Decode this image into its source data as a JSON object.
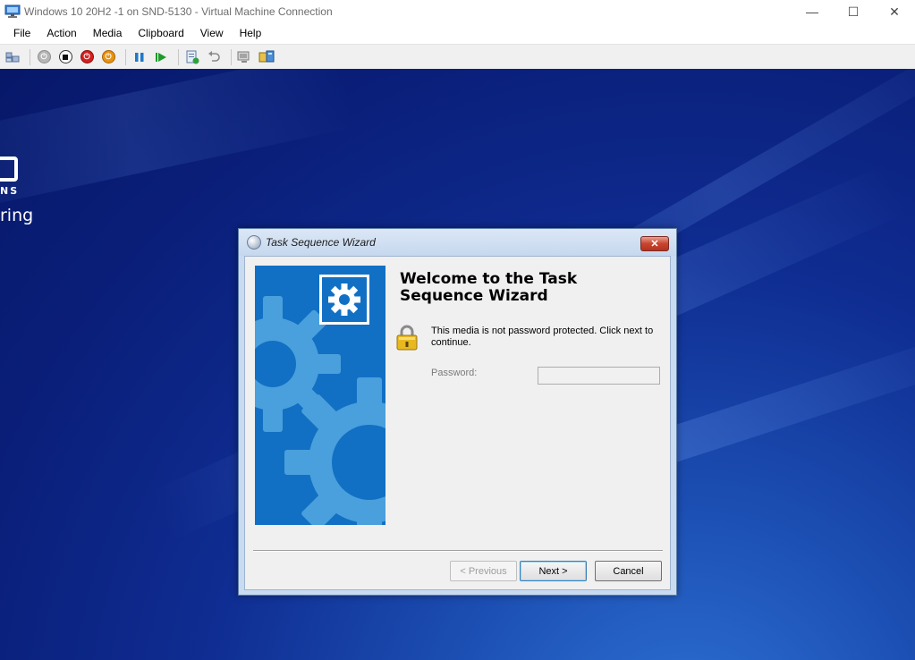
{
  "window": {
    "title": "Windows 10 20H2 -1 on SND-5130 - Virtual Machine Connection",
    "minimize": "—",
    "maximize": "☐",
    "close": "✕"
  },
  "menu": {
    "items": [
      "File",
      "Action",
      "Media",
      "Clipboard",
      "View",
      "Help"
    ]
  },
  "toolbar": {
    "icons": [
      "ctrl-alt-del-icon",
      "start-icon",
      "turn-off-icon",
      "shutdown-icon",
      "save-icon",
      "pause-icon",
      "reset-icon",
      "checkpoint-icon",
      "revert-icon",
      "enhanced-session-icon",
      "share-icon"
    ]
  },
  "desktop": {
    "brand_fragment": "NS",
    "brand_text": "ring"
  },
  "dialog": {
    "title": "Task Sequence Wizard",
    "close_label": "✕",
    "heading": "Welcome to the Task Sequence Wizard",
    "info_text": "This media is not password protected.  Click next to continue.",
    "password_label": "Password:",
    "password_value": "",
    "previous_label": "< Previous",
    "next_label": "Next >",
    "cancel_label": "Cancel"
  },
  "colors": {
    "desktop_blue": "#0f2d92",
    "wizard_blue": "#1170c4",
    "gear_light": "#4aa0dc"
  }
}
